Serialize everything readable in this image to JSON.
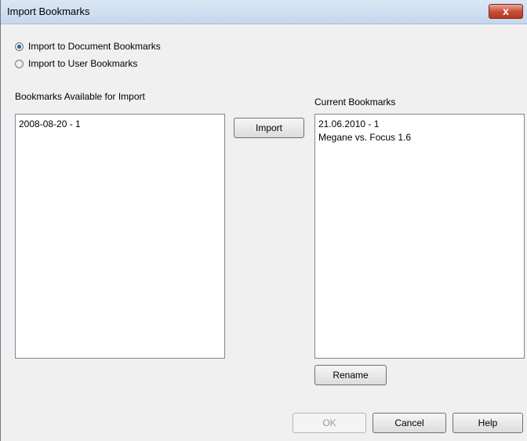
{
  "window": {
    "title": "Import Bookmarks",
    "close_label": "x"
  },
  "import_target": {
    "options": [
      {
        "label": "Import to Document Bookmarks",
        "checked": true
      },
      {
        "label": "Import to User Bookmarks",
        "checked": false
      }
    ]
  },
  "available": {
    "label": "Bookmarks Available for Import",
    "items": [
      "2008-08-20 - 1"
    ]
  },
  "current": {
    "label": "Current Bookmarks",
    "items": [
      "21.06.2010 - 1",
      "Megane vs. Focus 1.6"
    ]
  },
  "buttons": {
    "import": "Import",
    "rename": "Rename",
    "ok": "OK",
    "cancel": "Cancel",
    "help": "Help"
  }
}
